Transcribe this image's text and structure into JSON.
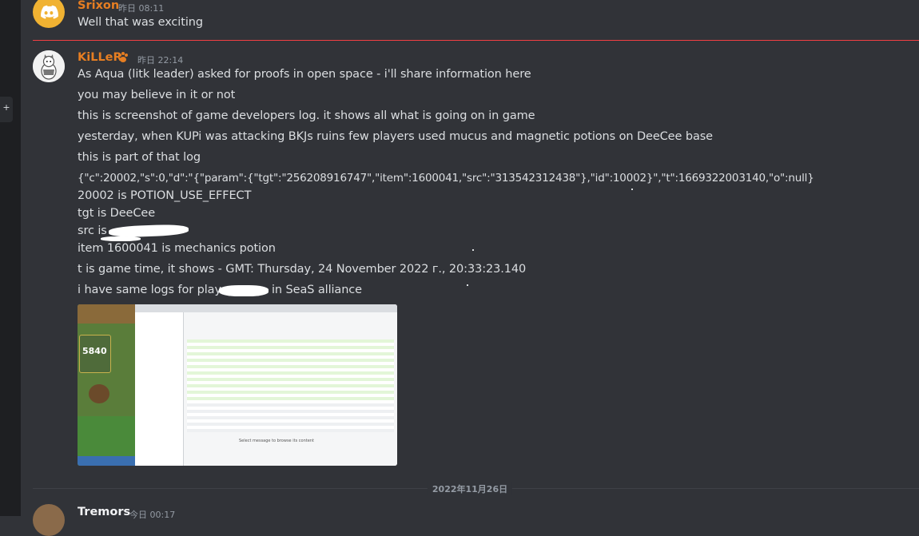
{
  "rail": {
    "add_label": "+"
  },
  "messages": [
    {
      "author": "Srixon",
      "timestamp": "昨日 08:11",
      "lines": [
        "Well that was exciting"
      ]
    },
    {
      "author": "KiLLeR",
      "author_badge": "paw-icon",
      "timestamp": "昨日 22:14",
      "lines": [
        "As Aqua (litk leader) asked for proofs in open space - i'll share information here",
        "you may believe in it or not",
        "this is screenshot of game developers log. it shows all what is going on in game",
        "yesterday, when KUPi was attacking BKJs ruins few players used mucus and magnetic potions on DeeCee base",
        "this is part of that log",
        "{\"c\":20002,\"s\":0,\"d\":\"{\"param\":{\"tgt\":\"256208916747\",\"item\":1600041,\"src\":\"313542312438\"},\"id\":10002}\",\"t\":1669322003140,\"o\":null}",
        "20002 is POTION_USE_EFFECT",
        "tgt is DeeCee",
        "src is",
        "item 1600041 is mechanics potion",
        "t is game time, it shows - GMT: Thursday, 24 November 2022 г., 20:33:23.140",
        "i have same logs for player",
        "in SeaS alliance"
      ],
      "attachment": {
        "game_score": "5840",
        "devtools_footer": "Select message to browse its content"
      }
    },
    {
      "author": "Tremors",
      "timestamp": "今日 00:17",
      "lines": []
    }
  ],
  "date_divider": "2022年11月26日",
  "colors": {
    "background": "#313338",
    "username": "#e67e22",
    "text": "#dbdee1",
    "timestamp": "#949ba4",
    "new_divider": "#f23f43",
    "discord_blurple": "#5865f2"
  }
}
